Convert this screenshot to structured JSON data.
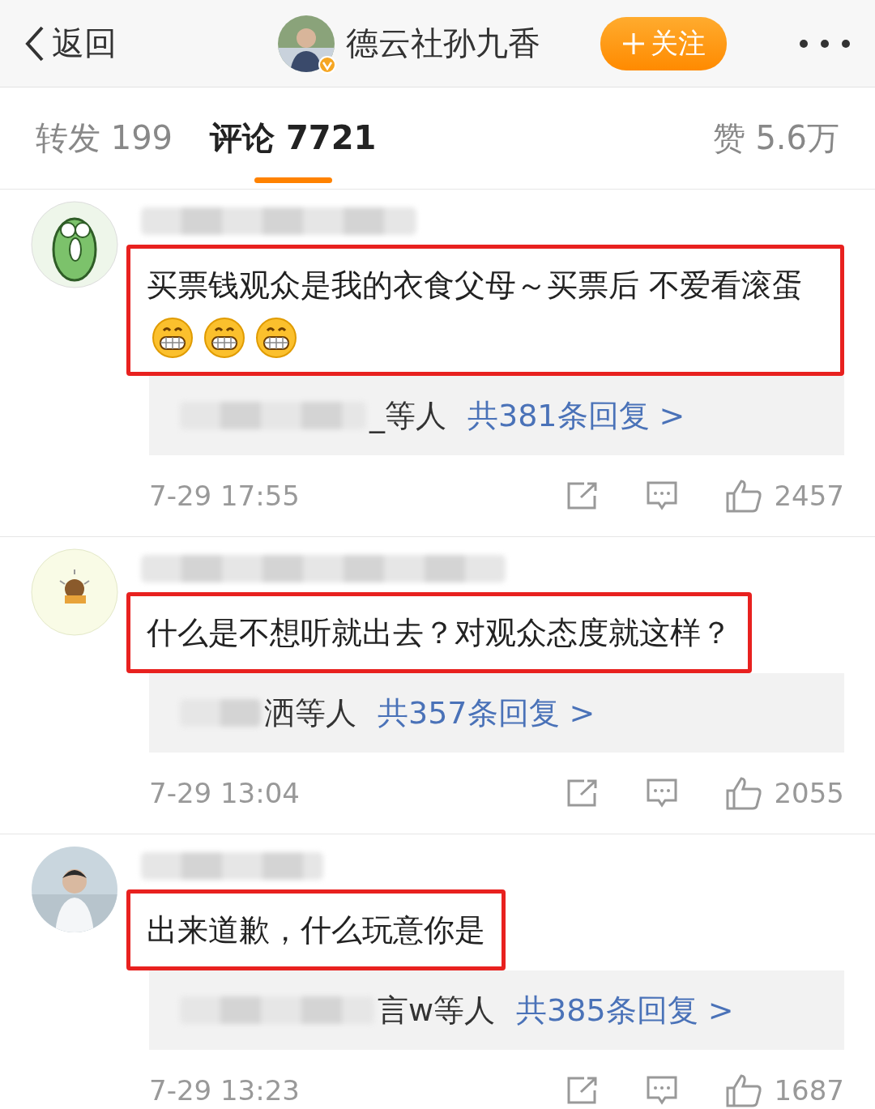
{
  "header": {
    "back_label": "返回",
    "account_name": "德云社孙九香",
    "verified": true,
    "follow_label": "关注"
  },
  "tabs": [
    {
      "label": "转发 199",
      "selected": false
    },
    {
      "label": "评论 7721",
      "selected": true
    }
  ],
  "likes_total": "赞 5.6万",
  "comments": [
    {
      "avatar": {
        "kind": "cartoon"
      },
      "highlighted": true,
      "text": "买票钱观众是我的衣食父母～买票后 不爱看滚蛋",
      "emojis": [
        {
          "kind": "grin"
        },
        {
          "kind": "grin"
        },
        {
          "kind": "grin"
        }
      ],
      "repliers_tail": "_等人",
      "reply_link": "共381条回复 >",
      "time": "7-29 17:55",
      "likes": "2457"
    },
    {
      "avatar": {
        "kind": "sticker"
      },
      "highlighted": true,
      "text": "什么是不想听就出去？对观众态度就这样？",
      "repliers_tail": "洒等人",
      "reply_link": "共357条回复 >",
      "time": "7-29 13:04",
      "likes": "2055"
    },
    {
      "highlighted": true,
      "text": "出来道歉，什么玩意你是",
      "repliers_tail": "言w等人",
      "reply_link": "共385条回复 >",
      "time": "7-29 13:23",
      "likes": "1687"
    }
  ]
}
